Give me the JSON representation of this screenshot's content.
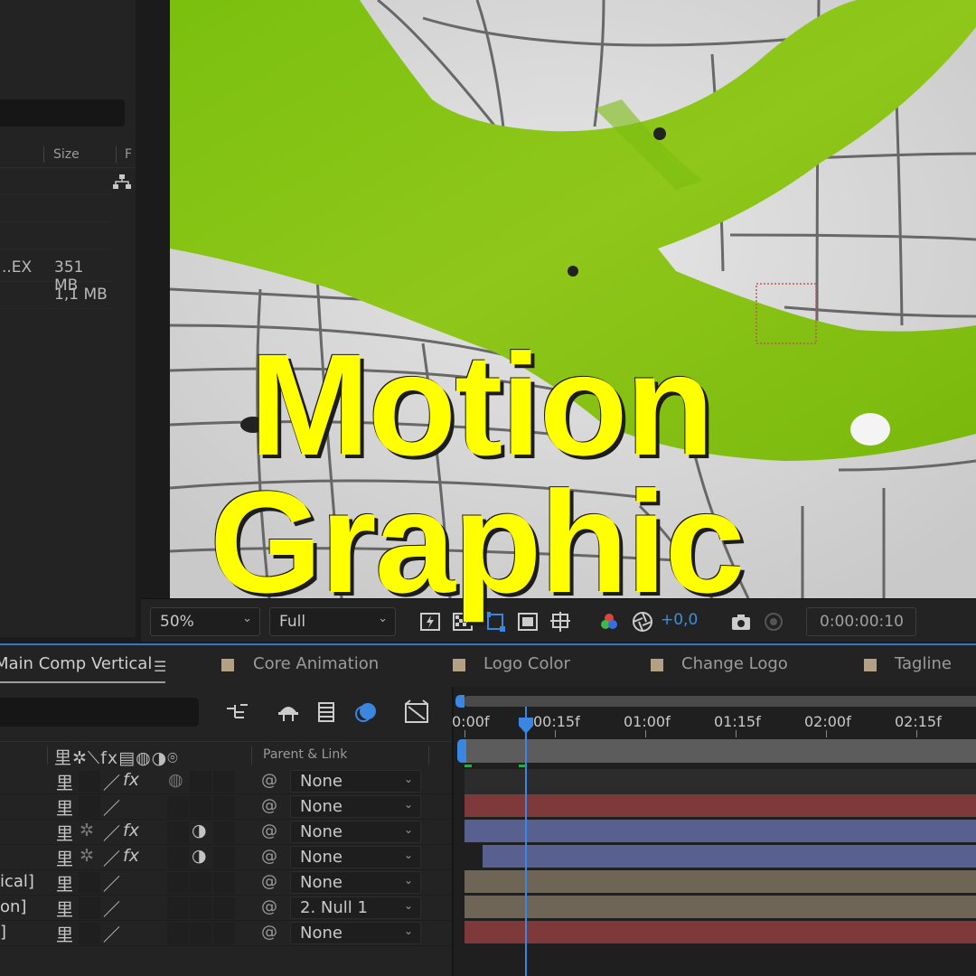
{
  "project_panel": {
    "columns": {
      "size": "Size",
      "f": "F"
    },
    "rows": [
      {
        "name": "..EX",
        "size": "351 MB"
      },
      {
        "name": "",
        "size": "1,1 MB"
      }
    ],
    "flow_icon": "flowchart-icon"
  },
  "viewer_toolbar": {
    "magnification": "50%",
    "resolution": "Full",
    "exposure": "+0,0",
    "timecode": "0:00:00:10",
    "icons": [
      "fast-preview-icon",
      "transparency-grid-icon",
      "mask-visibility-icon",
      "region-of-interest-icon",
      "guides-icon",
      "color-channels-icon",
      "exposure-reset-icon",
      "snapshot-icon",
      "show-snapshot-icon"
    ]
  },
  "timeline": {
    "tabs": [
      {
        "label": "Main Comp Vertical",
        "active": true
      },
      {
        "label": "Core Animation",
        "color": "#b3a085"
      },
      {
        "label": "Logo Color",
        "color": "#b3a085"
      },
      {
        "label": "Change Logo",
        "color": "#b3a085"
      },
      {
        "label": "Tagline",
        "color": "#b3a085"
      }
    ],
    "header": {
      "switch_icons": "⾥✲⟍fx▤◍◑⌾",
      "parent_link": "Parent & Link"
    },
    "layers": [
      {
        "name": "",
        "parent": "None",
        "bar_color": "#2c2c2c"
      },
      {
        "name": "",
        "parent": "None",
        "bar_color": "#7e3a3a"
      },
      {
        "name": "",
        "parent": "None",
        "bar_color": "#58608f"
      },
      {
        "name": "",
        "parent": "None",
        "bar_color": "#58608f"
      },
      {
        "name": "ical]",
        "parent": "None",
        "bar_color": "#6f6556"
      },
      {
        "name": "on]",
        "parent": "2. Null 1",
        "bar_color": "#6f6556"
      },
      {
        "name": "]",
        "parent": "None",
        "bar_color": "#7e3a3a"
      }
    ],
    "ruler": [
      "0:00f",
      "00:15f",
      "01:00f",
      "01:15f",
      "02:00f",
      "02:15f"
    ],
    "playhead_color": "#3a86e0"
  },
  "overlay_title": {
    "line1": "Motion",
    "line2": "Graphic",
    "color": "#ffff00"
  }
}
